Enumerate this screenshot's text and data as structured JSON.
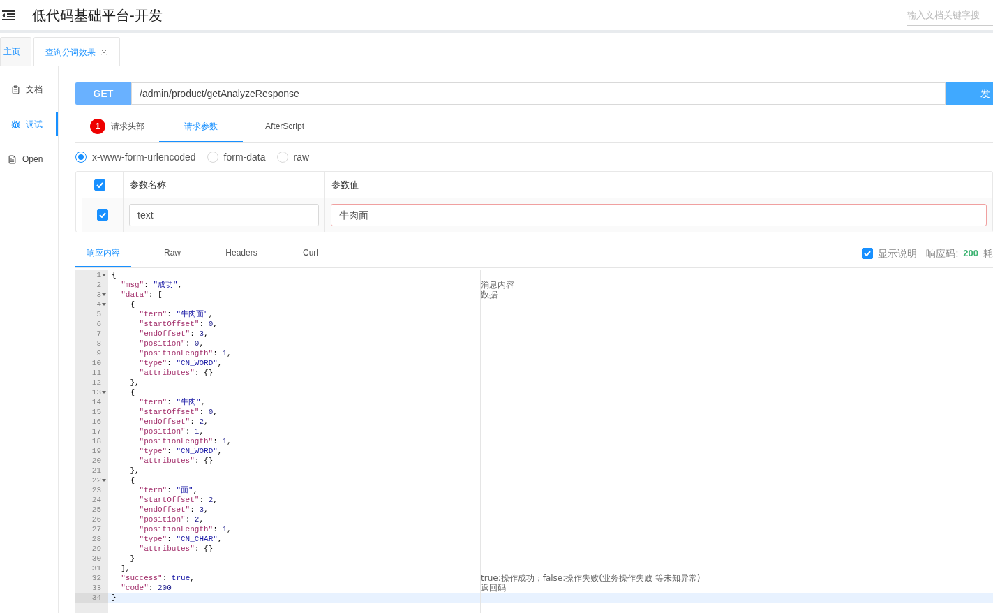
{
  "header": {
    "title": "低代码基础平台-开发",
    "search": {
      "placeholder": "输入文档关键字搜"
    }
  },
  "tabs": [
    {
      "label": "主页",
      "selected": false,
      "closable": false
    },
    {
      "label": "查询分词效果",
      "selected": true,
      "closable": true
    }
  ],
  "sidebar": {
    "items": [
      {
        "kind": "doc",
        "label": "文档",
        "selected": false
      },
      {
        "kind": "debug",
        "label": "调试",
        "selected": true
      },
      {
        "kind": "open",
        "label": "Open",
        "selected": false
      }
    ]
  },
  "request": {
    "method": "GET",
    "url": "/admin/product/getAnalyzeResponse",
    "send_label": "发"
  },
  "request_tabs": [
    {
      "label": "请求头部",
      "badge": "1",
      "selected": false
    },
    {
      "label": "请求参数",
      "selected": true
    },
    {
      "label": "AfterScript",
      "selected": false
    }
  ],
  "body_types": [
    {
      "label": "x-www-form-urlencoded",
      "selected": true
    },
    {
      "label": "form-data",
      "selected": false
    },
    {
      "label": "raw",
      "selected": false
    }
  ],
  "params": {
    "all_checked": true,
    "columns": [
      "参数名称",
      "参数值"
    ],
    "rows": [
      {
        "checked": true,
        "name": "text",
        "value": "牛肉面",
        "invalid": true
      }
    ]
  },
  "response_tabs": [
    {
      "label": "响应内容",
      "selected": true
    },
    {
      "label": "Raw",
      "selected": false
    },
    {
      "label": "Headers",
      "selected": false
    },
    {
      "label": "Curl",
      "selected": false
    }
  ],
  "response_meta": {
    "show_description": {
      "label": "显示说明",
      "checked": true
    },
    "status_label": "响应码:",
    "status": "200",
    "time_label": "耗"
  },
  "editor": {
    "lines": [
      {
        "no": "1",
        "fold": true,
        "current": false,
        "tokens": [
          {
            "kind": "punct",
            "text": "{"
          }
        ]
      },
      {
        "no": "2",
        "fold": false,
        "current": false,
        "note": "消息内容",
        "tokens": [
          {
            "kind": "key",
            "text": "  \"msg\""
          },
          {
            "kind": "punct",
            "text": ": "
          },
          {
            "kind": "string",
            "text": "\"成功\""
          },
          {
            "kind": "punct",
            "text": ","
          }
        ]
      },
      {
        "no": "3",
        "fold": true,
        "current": false,
        "note": "数据",
        "tokens": [
          {
            "kind": "key",
            "text": "  \"data\""
          },
          {
            "kind": "punct",
            "text": ": ["
          }
        ]
      },
      {
        "no": "4",
        "fold": true,
        "current": false,
        "tokens": [
          {
            "kind": "punct",
            "text": "    {"
          }
        ]
      },
      {
        "no": "5",
        "fold": false,
        "current": false,
        "tokens": [
          {
            "kind": "key",
            "text": "      \"term\""
          },
          {
            "kind": "punct",
            "text": ": "
          },
          {
            "kind": "string",
            "text": "\"牛肉面\""
          },
          {
            "kind": "punct",
            "text": ","
          }
        ]
      },
      {
        "no": "6",
        "fold": false,
        "current": false,
        "tokens": [
          {
            "kind": "key",
            "text": "      \"startOffset\""
          },
          {
            "kind": "punct",
            "text": ": "
          },
          {
            "kind": "number",
            "text": "0"
          },
          {
            "kind": "punct",
            "text": ","
          }
        ]
      },
      {
        "no": "7",
        "fold": false,
        "current": false,
        "tokens": [
          {
            "kind": "key",
            "text": "      \"endOffset\""
          },
          {
            "kind": "punct",
            "text": ": "
          },
          {
            "kind": "number",
            "text": "3"
          },
          {
            "kind": "punct",
            "text": ","
          }
        ]
      },
      {
        "no": "8",
        "fold": false,
        "current": false,
        "tokens": [
          {
            "kind": "key",
            "text": "      \"position\""
          },
          {
            "kind": "punct",
            "text": ": "
          },
          {
            "kind": "number",
            "text": "0"
          },
          {
            "kind": "punct",
            "text": ","
          }
        ]
      },
      {
        "no": "9",
        "fold": false,
        "current": false,
        "tokens": [
          {
            "kind": "key",
            "text": "      \"positionLength\""
          },
          {
            "kind": "punct",
            "text": ": "
          },
          {
            "kind": "number",
            "text": "1"
          },
          {
            "kind": "punct",
            "text": ","
          }
        ]
      },
      {
        "no": "10",
        "fold": false,
        "current": false,
        "tokens": [
          {
            "kind": "key",
            "text": "      \"type\""
          },
          {
            "kind": "punct",
            "text": ": "
          },
          {
            "kind": "string",
            "text": "\"CN_WORD\""
          },
          {
            "kind": "punct",
            "text": ","
          }
        ]
      },
      {
        "no": "11",
        "fold": false,
        "current": false,
        "tokens": [
          {
            "kind": "key",
            "text": "      \"attributes\""
          },
          {
            "kind": "punct",
            "text": ": {}"
          }
        ]
      },
      {
        "no": "12",
        "fold": false,
        "current": false,
        "tokens": [
          {
            "kind": "punct",
            "text": "    },"
          }
        ]
      },
      {
        "no": "13",
        "fold": true,
        "current": false,
        "tokens": [
          {
            "kind": "punct",
            "text": "    {"
          }
        ]
      },
      {
        "no": "14",
        "fold": false,
        "current": false,
        "tokens": [
          {
            "kind": "key",
            "text": "      \"term\""
          },
          {
            "kind": "punct",
            "text": ": "
          },
          {
            "kind": "string",
            "text": "\"牛肉\""
          },
          {
            "kind": "punct",
            "text": ","
          }
        ]
      },
      {
        "no": "15",
        "fold": false,
        "current": false,
        "tokens": [
          {
            "kind": "key",
            "text": "      \"startOffset\""
          },
          {
            "kind": "punct",
            "text": ": "
          },
          {
            "kind": "number",
            "text": "0"
          },
          {
            "kind": "punct",
            "text": ","
          }
        ]
      },
      {
        "no": "16",
        "fold": false,
        "current": false,
        "tokens": [
          {
            "kind": "key",
            "text": "      \"endOffset\""
          },
          {
            "kind": "punct",
            "text": ": "
          },
          {
            "kind": "number",
            "text": "2"
          },
          {
            "kind": "punct",
            "text": ","
          }
        ]
      },
      {
        "no": "17",
        "fold": false,
        "current": false,
        "tokens": [
          {
            "kind": "key",
            "text": "      \"position\""
          },
          {
            "kind": "punct",
            "text": ": "
          },
          {
            "kind": "number",
            "text": "1"
          },
          {
            "kind": "punct",
            "text": ","
          }
        ]
      },
      {
        "no": "18",
        "fold": false,
        "current": false,
        "tokens": [
          {
            "kind": "key",
            "text": "      \"positionLength\""
          },
          {
            "kind": "punct",
            "text": ": "
          },
          {
            "kind": "number",
            "text": "1"
          },
          {
            "kind": "punct",
            "text": ","
          }
        ]
      },
      {
        "no": "19",
        "fold": false,
        "current": false,
        "tokens": [
          {
            "kind": "key",
            "text": "      \"type\""
          },
          {
            "kind": "punct",
            "text": ": "
          },
          {
            "kind": "string",
            "text": "\"CN_WORD\""
          },
          {
            "kind": "punct",
            "text": ","
          }
        ]
      },
      {
        "no": "20",
        "fold": false,
        "current": false,
        "tokens": [
          {
            "kind": "key",
            "text": "      \"attributes\""
          },
          {
            "kind": "punct",
            "text": ": {}"
          }
        ]
      },
      {
        "no": "21",
        "fold": false,
        "current": false,
        "tokens": [
          {
            "kind": "punct",
            "text": "    },"
          }
        ]
      },
      {
        "no": "22",
        "fold": true,
        "current": false,
        "tokens": [
          {
            "kind": "punct",
            "text": "    {"
          }
        ]
      },
      {
        "no": "23",
        "fold": false,
        "current": false,
        "tokens": [
          {
            "kind": "key",
            "text": "      \"term\""
          },
          {
            "kind": "punct",
            "text": ": "
          },
          {
            "kind": "string",
            "text": "\"面\""
          },
          {
            "kind": "punct",
            "text": ","
          }
        ]
      },
      {
        "no": "24",
        "fold": false,
        "current": false,
        "tokens": [
          {
            "kind": "key",
            "text": "      \"startOffset\""
          },
          {
            "kind": "punct",
            "text": ": "
          },
          {
            "kind": "number",
            "text": "2"
          },
          {
            "kind": "punct",
            "text": ","
          }
        ]
      },
      {
        "no": "25",
        "fold": false,
        "current": false,
        "tokens": [
          {
            "kind": "key",
            "text": "      \"endOffset\""
          },
          {
            "kind": "punct",
            "text": ": "
          },
          {
            "kind": "number",
            "text": "3"
          },
          {
            "kind": "punct",
            "text": ","
          }
        ]
      },
      {
        "no": "26",
        "fold": false,
        "current": false,
        "tokens": [
          {
            "kind": "key",
            "text": "      \"position\""
          },
          {
            "kind": "punct",
            "text": ": "
          },
          {
            "kind": "number",
            "text": "2"
          },
          {
            "kind": "punct",
            "text": ","
          }
        ]
      },
      {
        "no": "27",
        "fold": false,
        "current": false,
        "tokens": [
          {
            "kind": "key",
            "text": "      \"positionLength\""
          },
          {
            "kind": "punct",
            "text": ": "
          },
          {
            "kind": "number",
            "text": "1"
          },
          {
            "kind": "punct",
            "text": ","
          }
        ]
      },
      {
        "no": "28",
        "fold": false,
        "current": false,
        "tokens": [
          {
            "kind": "key",
            "text": "      \"type\""
          },
          {
            "kind": "punct",
            "text": ": "
          },
          {
            "kind": "string",
            "text": "\"CN_CHAR\""
          },
          {
            "kind": "punct",
            "text": ","
          }
        ]
      },
      {
        "no": "29",
        "fold": false,
        "current": false,
        "tokens": [
          {
            "kind": "key",
            "text": "      \"attributes\""
          },
          {
            "kind": "punct",
            "text": ": {}"
          }
        ]
      },
      {
        "no": "30",
        "fold": false,
        "current": false,
        "tokens": [
          {
            "kind": "punct",
            "text": "    }"
          }
        ]
      },
      {
        "no": "31",
        "fold": false,
        "current": false,
        "tokens": [
          {
            "kind": "punct",
            "text": "  ],"
          }
        ]
      },
      {
        "no": "32",
        "fold": false,
        "current": false,
        "note": "true:操作成功；false:操作失败(业务操作失败 等未知异常)",
        "tokens": [
          {
            "kind": "key",
            "text": "  \"success\""
          },
          {
            "kind": "punct",
            "text": ": "
          },
          {
            "kind": "bool",
            "text": "true"
          },
          {
            "kind": "punct",
            "text": ","
          }
        ]
      },
      {
        "no": "33",
        "fold": false,
        "current": false,
        "note": "返回码",
        "tokens": [
          {
            "kind": "key",
            "text": "  \"code\""
          },
          {
            "kind": "punct",
            "text": ": "
          },
          {
            "kind": "number",
            "text": "200"
          }
        ]
      },
      {
        "no": "34",
        "fold": false,
        "current": true,
        "tokens": [
          {
            "kind": "punct",
            "text": "}"
          }
        ]
      }
    ]
  }
}
